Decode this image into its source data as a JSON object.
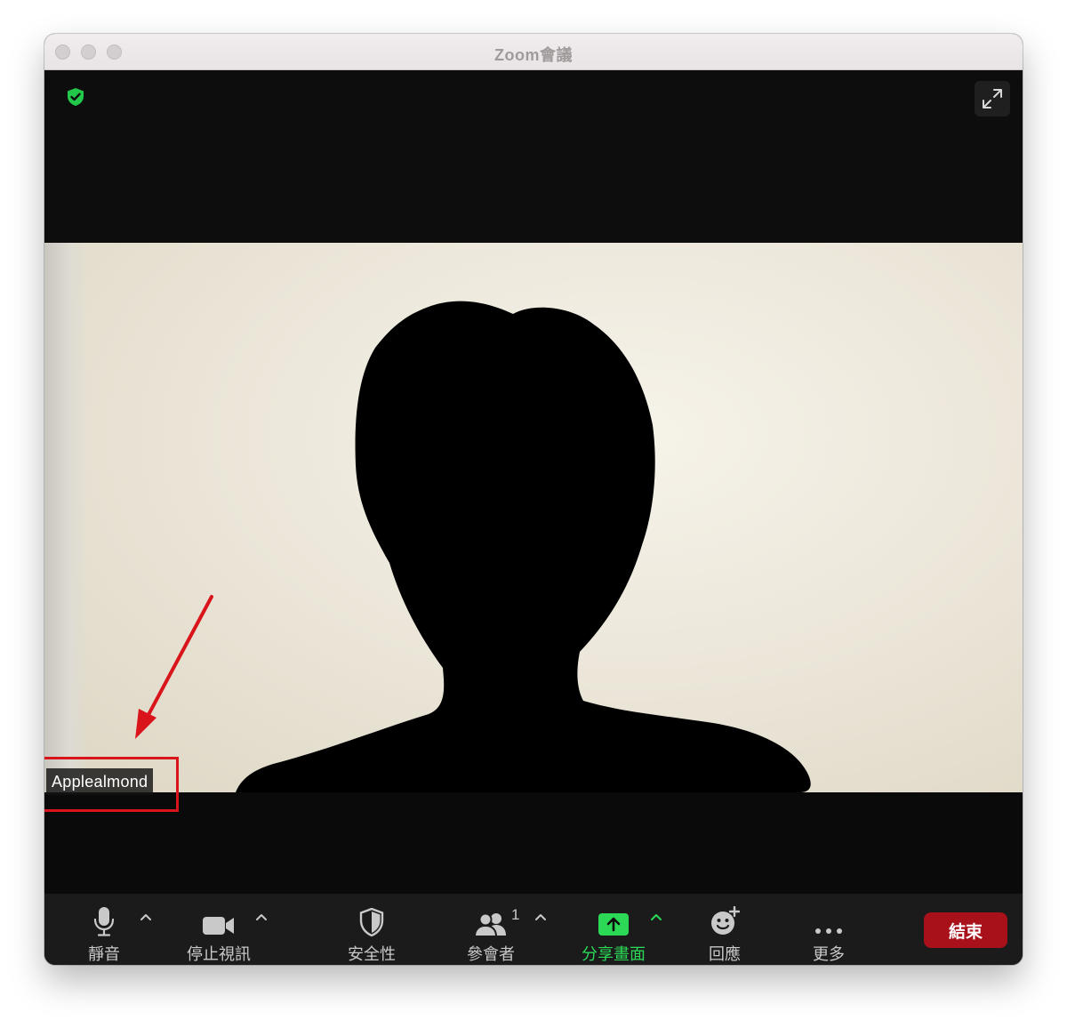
{
  "window": {
    "title": "Zoom會議"
  },
  "video": {
    "participant_name": "Applealmond"
  },
  "toolbar": {
    "mute_label": "靜音",
    "stop_video_label": "停止視訊",
    "security_label": "安全性",
    "participants_label": "參會者",
    "participants_count": "1",
    "share_screen_label": "分享畫面",
    "reactions_label": "回應",
    "more_label": "更多",
    "end_label": "結束"
  },
  "icons": {
    "encryption": "shield-check-icon",
    "fullscreen": "expand-arrows-icon",
    "mute": "microphone-icon",
    "video": "video-camera-icon",
    "security": "shield-icon",
    "participants": "people-icon",
    "share": "share-up-arrow-icon",
    "reactions": "emoji-plus-icon",
    "more": "ellipsis-icon"
  },
  "colors": {
    "accent_green": "#2bd957",
    "end_red": "#a8101a",
    "annotation_red": "#d9141b"
  }
}
